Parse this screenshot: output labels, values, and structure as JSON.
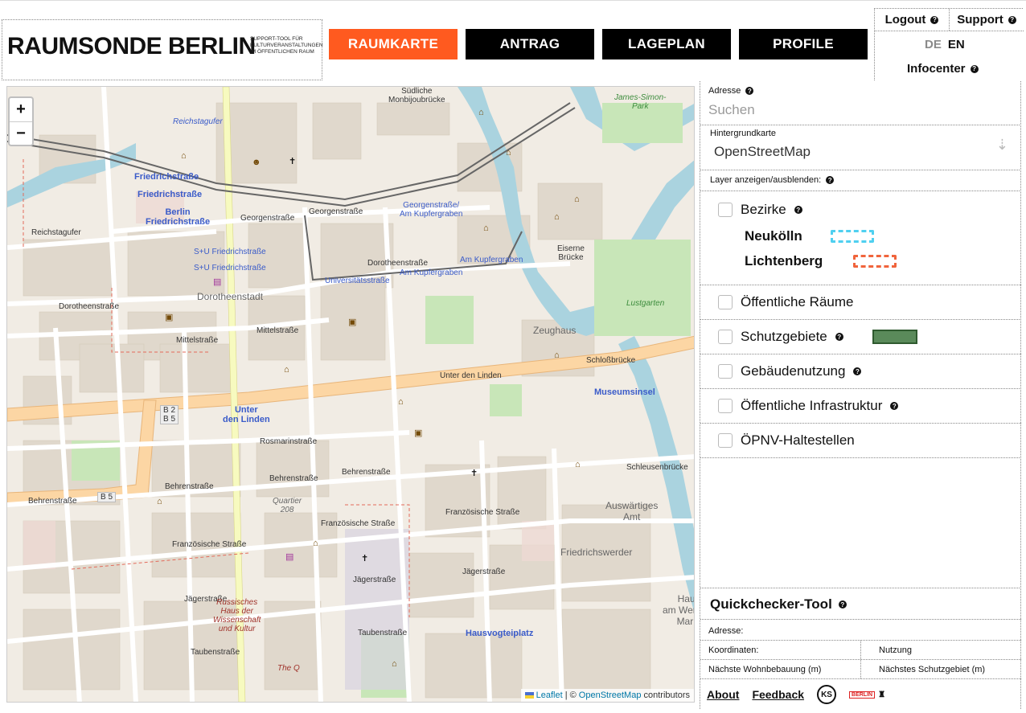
{
  "header": {
    "logo_title": "RAUMSONDE BERLIN",
    "logo_subtitle": "SUPPORT-TOOL FÜR KULTURVERANSTALTUNGEN IM ÖFFENTLICHEN RAUM",
    "nav": [
      {
        "label": "RAUMKARTE",
        "active": true
      },
      {
        "label": "ANTRAG",
        "active": false
      },
      {
        "label": "LAGEPLAN",
        "active": false
      },
      {
        "label": "PROFILE",
        "active": false
      }
    ],
    "logout": "Logout",
    "support": "Support",
    "lang_de": "DE",
    "lang_en": "EN",
    "infocenter": "Infocenter",
    "accent_color": "#ff5a1f"
  },
  "map": {
    "zoom_in": "+",
    "zoom_out": "−",
    "attribution_leaflet": "Leaflet",
    "attribution_sep": "| ©",
    "attribution_osm": "OpenStreetMap",
    "attribution_tail": "contributors",
    "labels": {
      "friedrichstrasse1": "Friedrichstraße",
      "friedrichstrasse2": "Friedrichstraße",
      "berlin_friedrichstrasse": "Berlin\nFriedrichstraße",
      "su_friedrichstrasse1": "S+U Friedrichstraße",
      "su_friedrichstrasse2": "S+U Friedrichstraße",
      "dorotheenstadt": "Dorotheenstadt",
      "georgenstrasse1": "Georgenstraße",
      "georgenstrasse2": "Georgenstraße",
      "georgenstrasse_kupfergraben": "Georgenstraße/\nAm Kupfergraben",
      "dorotheenstrasse1": "Dorotheenstraße",
      "dorotheenstrasse2": "Dorotheenstraße",
      "universitaetsstrasse": "Universitätsstraße",
      "am_kupfergraben1": "Am Kupfergraben",
      "am_kupfergraben2": "Am Kupfergraben",
      "mittelstrasse1": "Mittelstraße",
      "mittelstrasse2": "Mittelstraße",
      "unter_den_linden": "Unter den Linden",
      "unter_den_linden_stop": "Unter\nden Linden",
      "schlossbruecke": "Schloßbrücke",
      "museumsinsel": "Museumsinsel",
      "zeughaus": "Zeughaus",
      "eiserne_bruecke": "Eiserne\nBrücke",
      "lustgarten": "Lustgarten",
      "james_simon_park": "James-Simon-\nPark",
      "behrenstrasse1": "Behrenstraße",
      "behrenstrasse2": "Behrenstraße",
      "behrenstrasse3": "Behrenstraße",
      "behrenstrasse4": "Behrenstraße",
      "rosmarinstrasse": "Rosmarinstraße",
      "franzoesische1": "Französische Straße",
      "franzoesische2": "Französische Straße",
      "franzoesische3": "Französische Straße",
      "jaegerstrasse1": "Jägerstraße",
      "jaegerstrasse2": "Jägerstraße",
      "jaegerstrasse3": "Jägerstraße",
      "taubenstrasse1": "Taubenstraße",
      "taubenstrasse2": "Taubenstraße",
      "hausvogteiplatz": "Hausvogteiplatz",
      "friedrichswerder": "Friedrichswerder",
      "auswaertiges_amt": "Auswärtiges\nAmt",
      "quartier208": "Quartier\n208",
      "russisches_haus": "Russisches\nHaus der\nWissenschaft\nund Kultur",
      "the_q": "The Q",
      "schleusenbruecke": "Schleusenbrücke",
      "reichstagufer1": "Reichstagufer",
      "reichstagufer2": "Reichstagufer",
      "dorotheenstrasse_w": "Dorotheenstraße",
      "monbijou": "Südliche\nMonbijoubrücke",
      "b2b5": "B 2\nB 5",
      "b5": "B 5",
      "haus_werder": "Haus\nam Werders\nMarkt"
    }
  },
  "panel": {
    "address_label": "Adresse",
    "search_placeholder": "Suchen",
    "bg_label": "Hintergrundkarte",
    "bg_value": "OpenStreetMap",
    "layer_label": "Layer anzeigen/ausblenden:",
    "bezirke": "Bezirke",
    "neukoelln": "Neukölln",
    "lichtenberg": "Lichtenberg",
    "neukoelln_color": "#4fd0f0",
    "lichtenberg_color": "#f0643c",
    "oeffentliche_raeume": "Öffentliche Räume",
    "schutzgebiete": "Schutzgebiete",
    "schutzgebiete_color": "#5a8a5a",
    "gebaeudenutzung": "Gebäudenutzung",
    "infrastruktur": "Öffentliche Infrastruktur",
    "oepnv": "ÖPNV-Haltestellen",
    "quickchecker": "Quickchecker-Tool",
    "qc_adresse": "Adresse:",
    "qc_koordinaten": "Koordinaten:",
    "qc_nutzung": "Nutzung",
    "qc_wohnbebauung": "Nächste Wohnbebauung (m)",
    "qc_schutzgebiet": "Nächstes Schutzgebiet (m)",
    "about": "About",
    "feedback": "Feedback",
    "ks_logo": "KS",
    "berlin_logo": "BERLIN"
  }
}
